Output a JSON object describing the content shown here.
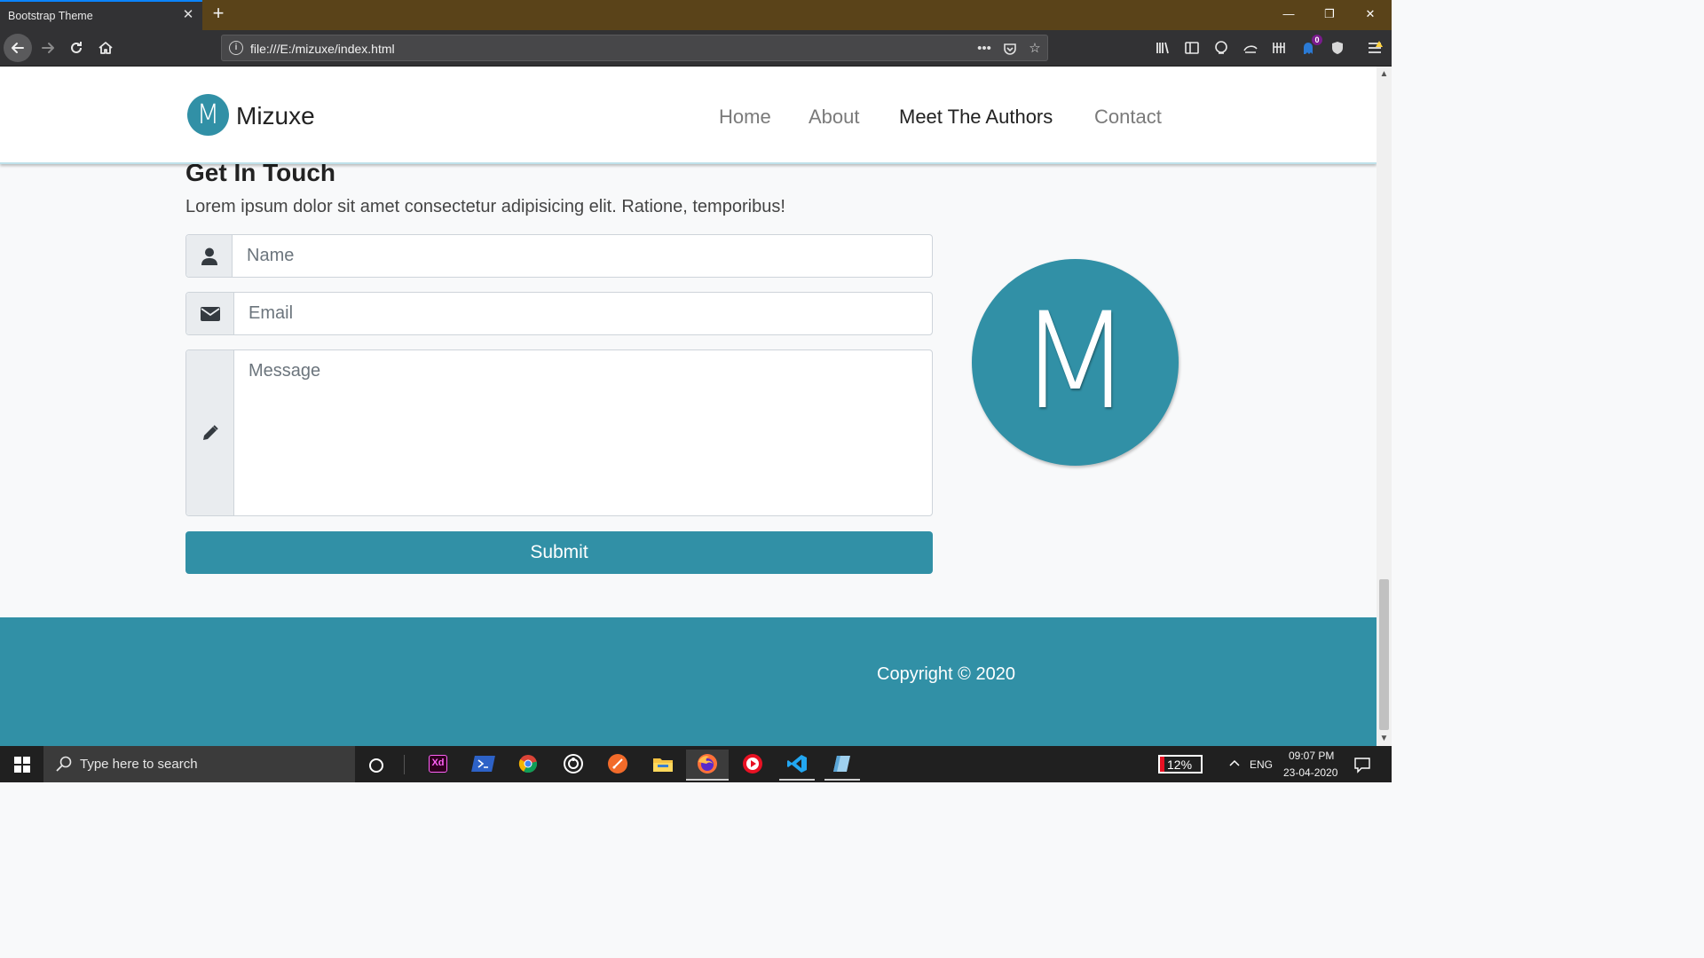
{
  "browser": {
    "tab_title": "Bootstrap Theme",
    "url": "file:///E:/mizuxe/index.html",
    "notification_count": "0"
  },
  "site": {
    "brand_letter": "M",
    "brand_name": "Mizuxe",
    "nav": [
      {
        "label": "Home",
        "active": false
      },
      {
        "label": "About",
        "active": false
      },
      {
        "label": "Meet The Authors",
        "active": true
      },
      {
        "label": "Contact",
        "active": false
      }
    ],
    "contact": {
      "title": "Get In Touch",
      "text": "Lorem ipsum dolor sit amet consectetur adipisicing elit. Ratione, temporibus!",
      "name_placeholder": "Name",
      "email_placeholder": "Email",
      "message_placeholder": "Message",
      "submit_label": "Submit"
    },
    "logo_letter": "M",
    "footer_text": "Copyright © 2020"
  },
  "taskbar": {
    "search_placeholder": "Type here to search",
    "battery": "12%",
    "language": "ENG",
    "time": "09:07 PM",
    "date": "23-04-2020"
  },
  "colors": {
    "brand": "#3190a6",
    "firefox_tabstrip": "#5a4319",
    "toolbar": "#323234"
  }
}
